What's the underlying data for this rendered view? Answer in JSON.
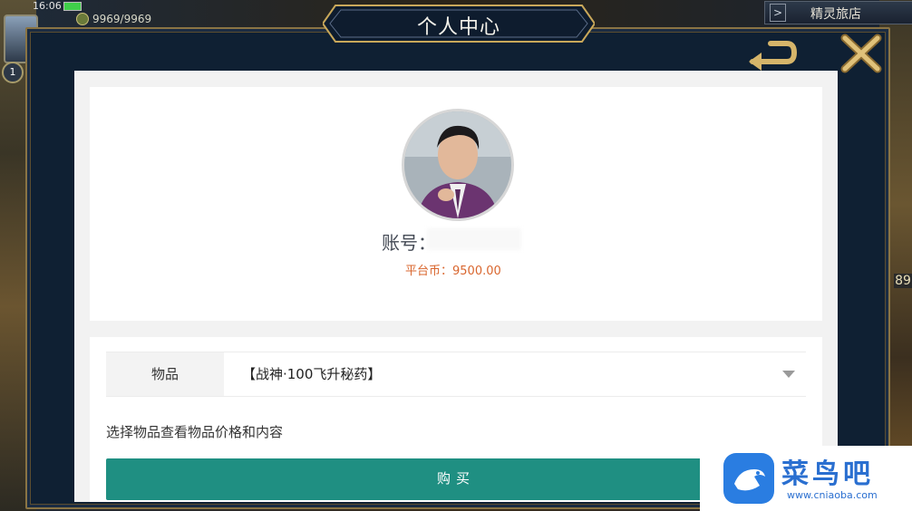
{
  "status": {
    "time": "16:06",
    "hp": "9969/9969"
  },
  "side": {
    "level": "1",
    "right_num": "89"
  },
  "inn": {
    "arrow": ">",
    "label": "精灵旅店"
  },
  "dialog": {
    "title": "个人中心"
  },
  "profile": {
    "account_label": "账号：",
    "coin_line": "平台币：9500.00"
  },
  "item": {
    "label": "物品",
    "selected": "【战神·100飞升秘药】",
    "hint": "选择物品查看物品价格和内容",
    "buy_label": "购买"
  },
  "watermark": {
    "name": "菜鸟吧",
    "url": "www.cniaoba.com"
  },
  "icons": [
    "back-icon",
    "close-icon",
    "dropdown-caret-icon",
    "hp-icon"
  ],
  "colors": {
    "accent": "#1f8f82",
    "coin": "#d9662e",
    "frame": "#0f2033",
    "gold": "#c9a85a"
  }
}
